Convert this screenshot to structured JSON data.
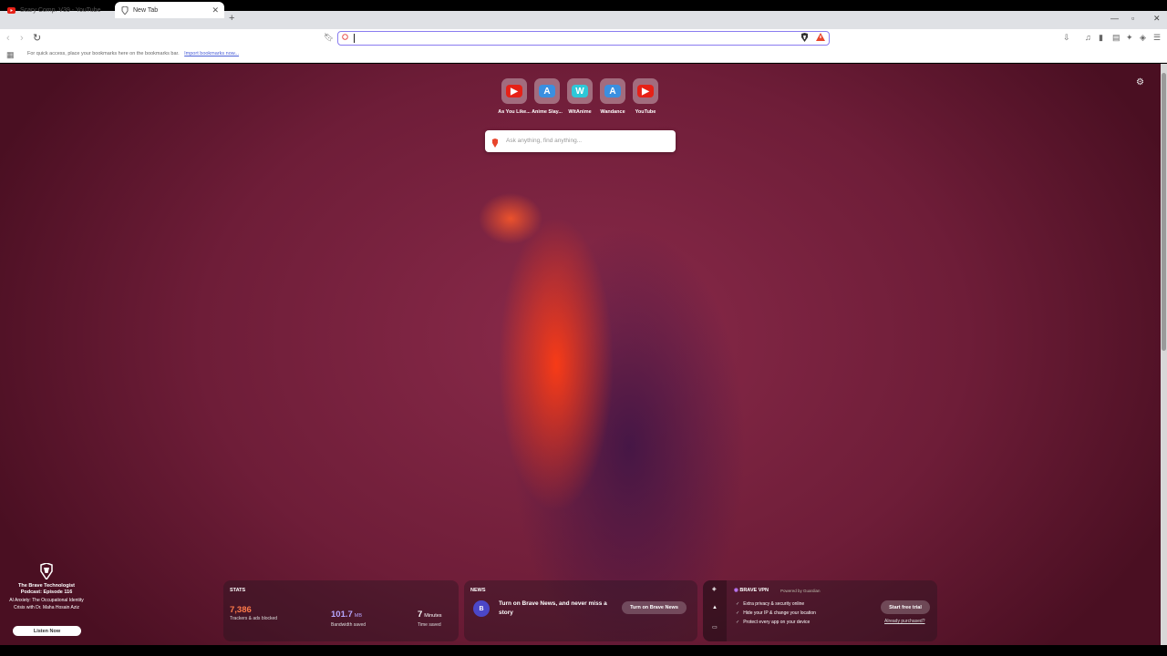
{
  "tabs": [
    {
      "title": "Scary Comp. V39 - YouTube",
      "active": false
    },
    {
      "title": "New Tab",
      "active": true
    }
  ],
  "bookmarks_bar": {
    "text": "For quick access, place your bookmarks here on the bookmarks bar.",
    "link": "Import bookmarks now..."
  },
  "top_sites": [
    {
      "label": "As You Like...",
      "icon": "youtube-icon",
      "glyph": "▶",
      "color": "#e62117"
    },
    {
      "label": "Anime Slay...",
      "icon": "anime-slayer-icon",
      "glyph": "A",
      "color": "#3a8fe0"
    },
    {
      "label": "WitAnime",
      "icon": "witanime-icon",
      "glyph": "W",
      "color": "#2ec8d8"
    },
    {
      "label": "Wandance",
      "icon": "wandance-icon",
      "glyph": "A",
      "color": "#3a8fe0"
    },
    {
      "label": "YouTube",
      "icon": "youtube-icon",
      "glyph": "▶",
      "color": "#e62117"
    }
  ],
  "search": {
    "placeholder": "Ask anything, find anything..."
  },
  "podcast": {
    "title": "The Brave Technologist Podcast: Episode 116",
    "description": "AI Anxiety: The Occupational Identity Crisis with Dr. Maha Hosain Aziz",
    "button": "Listen Now"
  },
  "stats": {
    "heading": "STATS",
    "trackers": {
      "value": "7,386",
      "label": "Trackers & ads blocked",
      "color": "#ff7a4a"
    },
    "bandwidth": {
      "value": "101.7",
      "unit": "MB",
      "label": "Bandwidth saved",
      "color": "#b6a6ff"
    },
    "time": {
      "value": "7",
      "unit": "Minutes",
      "label": "Time saved",
      "color": "#ffffff"
    }
  },
  "news": {
    "heading": "NEWS",
    "text": "Turn on Brave News, and never miss a story",
    "button": "Turn on Brave News"
  },
  "vpn": {
    "title": "BRAVE VPN",
    "powered": "Powered by Guardian",
    "features": [
      "Extra privacy & security online",
      "Hide your IP & change your location",
      "Protect every app on your device"
    ],
    "button": "Start free trial",
    "link": "Already purchased?"
  }
}
